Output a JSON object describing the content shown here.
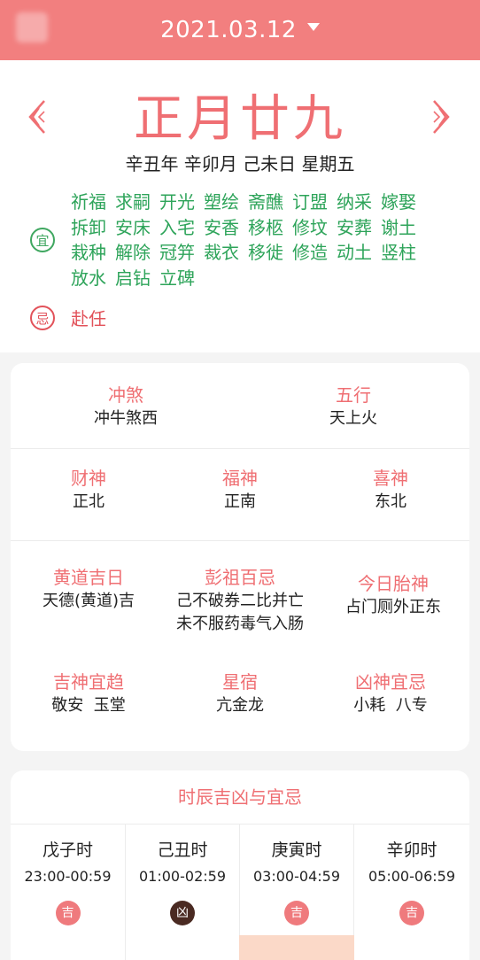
{
  "header": {
    "date": "2021.03.12"
  },
  "day": {
    "lunar_date": "正月廿九",
    "ganzhi": "辛丑年 辛卯月 己未日 星期五",
    "yi_badge": "宜",
    "ji_badge": "忌",
    "yi_items": [
      "祈福",
      "求嗣",
      "开光",
      "塑绘",
      "斋醮",
      "订盟",
      "纳采",
      "嫁娶",
      "拆卸",
      "安床",
      "入宅",
      "安香",
      "移柩",
      "修坟",
      "安葬",
      "谢土",
      "栽种",
      "解除",
      "冠笄",
      "裁衣",
      "移徙",
      "修造",
      "动土",
      "竖柱",
      "放水",
      "启钻",
      "立碑"
    ],
    "ji_items": [
      "赴任"
    ]
  },
  "info": {
    "chongsha": {
      "label": "冲煞",
      "value": "冲牛煞西"
    },
    "wuxing": {
      "label": "五行",
      "value": "天上火"
    },
    "caishen": {
      "label": "财神",
      "value": "正北"
    },
    "fushen": {
      "label": "福神",
      "value": "正南"
    },
    "xishen": {
      "label": "喜神",
      "value": "东北"
    },
    "huangdao": {
      "label": "黄道吉日",
      "value": "天德(黄道)吉"
    },
    "pengzu": {
      "label": "彭祖百忌",
      "value_line1": "己不破券二比并亡",
      "value_line2": "未不服药毒气入肠"
    },
    "taishen": {
      "label": "今日胎神",
      "value": "占门厕外正东"
    },
    "jishen": {
      "label": "吉神宜趋",
      "value": "敬安  玉堂"
    },
    "xingxiu": {
      "label": "星宿",
      "value": "亢金龙"
    },
    "xiongshen": {
      "label": "凶神宜忌",
      "value": "小耗  八专"
    }
  },
  "hours": {
    "title": "时辰吉凶与宜忌",
    "items": [
      {
        "name": "戊子时",
        "range": "23:00-00:59",
        "luck": "吉",
        "type": "good"
      },
      {
        "name": "己丑时",
        "range": "01:00-02:59",
        "luck": "凶",
        "type": "bad"
      },
      {
        "name": "庚寅时",
        "range": "03:00-04:59",
        "luck": "吉",
        "type": "good"
      },
      {
        "name": "辛卯时",
        "range": "05:00-06:59",
        "luck": "吉",
        "type": "good"
      }
    ]
  },
  "colors": {
    "accent": "#f27f7f",
    "yi_green": "#2ea45a",
    "ji_red": "#e2525a",
    "bad_brown": "#4a2a22"
  }
}
